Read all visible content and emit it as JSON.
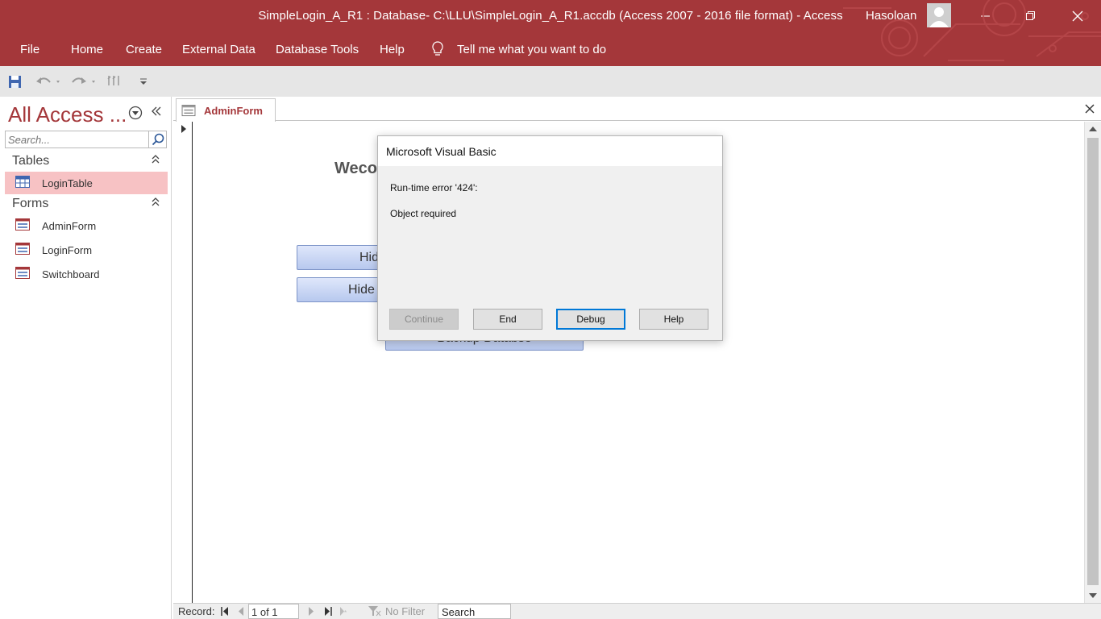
{
  "window": {
    "title": "SimpleLogin_A_R1 : Database- C:\\LLU\\SimpleLogin_A_R1.accdb (Access 2007 - 2016 file format)  -  Access",
    "user": "Hasoloan"
  },
  "ribbon": {
    "tabs": [
      "File",
      "Home",
      "Create",
      "External Data",
      "Database Tools",
      "Help"
    ],
    "tell_me": "Tell me what you want to do"
  },
  "nav": {
    "title": "All Access ...",
    "search_placeholder": "Search...",
    "groups": [
      {
        "label": "Tables",
        "items": [
          "LoginTable"
        ]
      },
      {
        "label": "Forms",
        "items": [
          "AdminForm",
          "LoginForm",
          "Switchboard"
        ]
      }
    ]
  },
  "document": {
    "tab_label": "AdminForm",
    "welcome_text": "Weco",
    "buttons": [
      "Hid",
      "Hide",
      "Backup Databse"
    ]
  },
  "record_nav": {
    "label": "Record:",
    "position": "1 of 1",
    "filter": "No Filter",
    "search": "Search"
  },
  "dialog": {
    "title": "Microsoft Visual Basic",
    "error_line": "Run-time error '424':",
    "message": "Object required",
    "buttons": [
      "Continue",
      "End",
      "Debug",
      "Help"
    ]
  },
  "colors": {
    "accent": "#a4373a",
    "selected_item": "#f7c2c4",
    "default_button_border": "#0078d7"
  }
}
